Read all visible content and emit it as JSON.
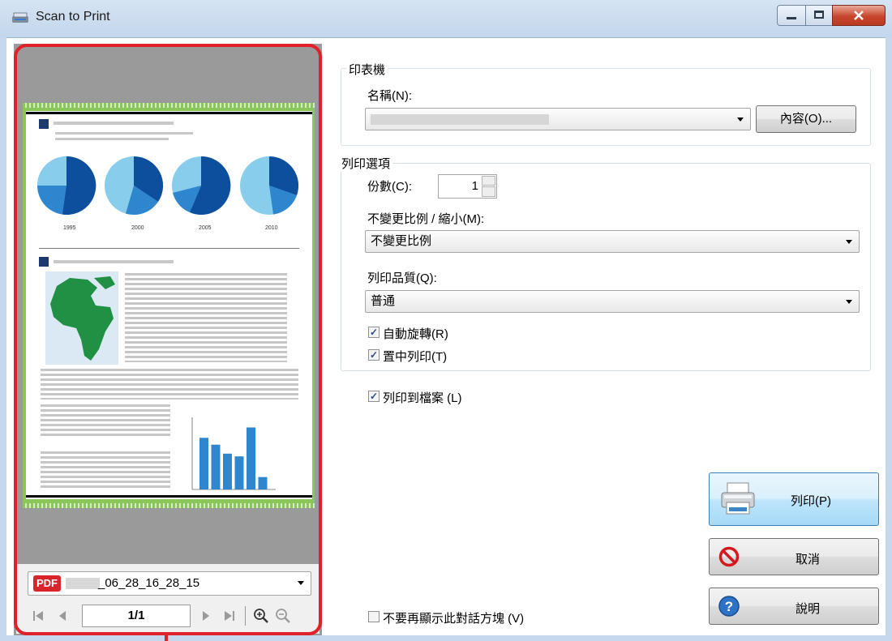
{
  "window": {
    "title": "Scan to Print",
    "icon": "scanner-icon"
  },
  "preview": {
    "filename": "_06_28_16_28_15",
    "file_badge": "PDF",
    "page_indicator": "1/1",
    "chart_years": [
      "1995",
      "2000",
      "2005",
      "2010"
    ],
    "bar_values": [
      75,
      65,
      52,
      48,
      90,
      18
    ]
  },
  "printer": {
    "group_label": "印表機",
    "name_label": "名稱(N):",
    "properties_button": "內容(O)..."
  },
  "options": {
    "group_label": "列印選項",
    "copies_label": "份數(C):",
    "copies_value": "1",
    "scale_label": "不變更比例 / 縮小(M):",
    "scale_value": "不變更比例",
    "quality_label": "列印品質(Q):",
    "quality_value": "普通",
    "auto_rotate": "自動旋轉(R)",
    "center_print": "置中列印(T)"
  },
  "print_to_file": "列印到檔案 (L)",
  "dont_show_again": "不要再顯示此對話方塊 (V)",
  "buttons": {
    "print": "列印(P)",
    "cancel": "取消",
    "help": "說明"
  },
  "colors": {
    "highlight": "#e0202b",
    "pie_dark": "#0d4f9c",
    "pie_mid": "#2e86cf",
    "pie_light": "#88cdec",
    "map_green": "#1f9044"
  }
}
